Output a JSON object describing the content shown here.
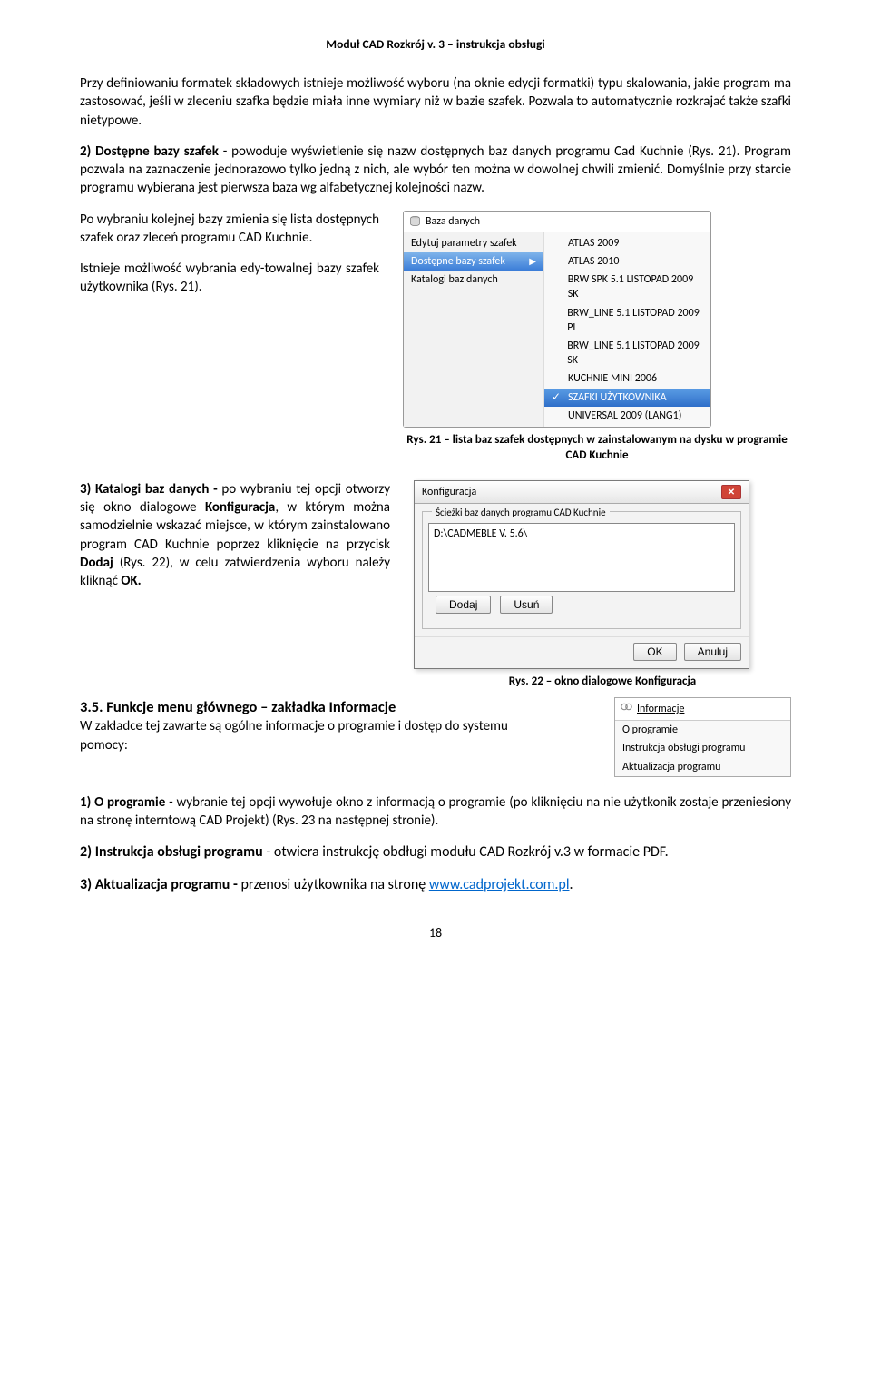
{
  "header": "Moduł CAD Rozkrój v. 3 – instrukcja obsługi",
  "p1": "Przy definiowaniu formatek składowych istnieje możliwość wyboru (na oknie edycji formatki) typu skalowania, jakie program ma zastosować, jeśli w zleceniu szafka będzie miała inne wymiary niż w bazie szafek. Pozwala to automatycznie rozkrajać także szafki nietypowe.",
  "p2a": "2) Dostępne bazy szafek",
  "p2b": " - powoduje wyświetlenie się nazw dostępnych baz danych programu Cad Kuchnie (Rys. 21). Program pozwala na zaznaczenie jednorazowo tylko jedną z nich, ale wybór ten można w dowolnej chwili zmienić. Domyślnie przy starcie programu wybierana jest pierwsza baza wg alfabetycznej kolejności nazw.",
  "left1": "Po wybraniu kolejnej bazy zmienia się lista dostępnych szafek oraz zleceń programu CAD Kuchnie.",
  "left2": "Istnieje możliwość wybrania edy-towalnej bazy szafek użytkownika (Rys. 21).",
  "menu": {
    "title": "Baza danych",
    "left": [
      "Edytuj parametry szafek",
      "Dostępne bazy szafek",
      "Katalogi baz danych"
    ],
    "right": [
      "ATLAS 2009",
      "ATLAS 2010",
      "BRW SPK 5.1 LISTOPAD 2009 SK",
      "BRW_LINE 5.1 LISTOPAD 2009 PL",
      "BRW_LINE 5.1 LISTOPAD 2009 SK",
      "KUCHNIE MINI 2006",
      "SZAFKI UŻYTKOWNIKA",
      "UNIVERSAL 2009 (LANG1)"
    ]
  },
  "cap21": "Rys. 21 – lista baz szafek dostępnych w zainstalowanym na dysku w programie CAD Kuchnie",
  "p3a": "3) Katalogi baz danych - ",
  "p3b": "po wybraniu tej opcji otworzy się okno dialogowe ",
  "p3c": "Konfiguracja",
  "p3d": ", w którym można samodzielnie wskazać miejsce, w którym zainstalowano program CAD Kuchnie poprzez kliknięcie na przycisk ",
  "p3e": "Dodaj",
  "p3f": " (Rys. 22), w celu zatwierdzenia wyboru należy kliknąć ",
  "p3g": "OK.",
  "dialog": {
    "title": "Konfiguracja",
    "fieldset": "Ścieżki baz danych programu CAD Kuchnie",
    "path": "D:\\CADMEBLE V. 5.6\\",
    "add": "Dodaj",
    "remove": "Usuń",
    "ok": "OK",
    "cancel": "Anuluj"
  },
  "cap22": "Rys. 22 – okno dialogowe Konfiguracja",
  "sec35h": "3.5. Funkcje menu głównego – zakładka Informacje",
  "sec35a": "W zakładce tej zawarte są ogólne informacje o programie i dostęp do systemu pomocy:",
  "info_menu": {
    "title": "Informacje",
    "items": [
      "O programie",
      "Instrukcja obsługi programu",
      "Aktualizacja programu"
    ]
  },
  "p4a": "1) O programie",
  "p4b": " - wybranie tej opcji wywołuje okno z  informacją o programie (po kliknięciu na nie użytkonik zostaje przeniesiony na stronę interntową CAD Projekt) (Rys. 23 na następnej stronie).",
  "p5a": "2) Instrukcja obsługi programu",
  "p5b": "  - otwiera instrukcję obdługi modułu CAD Rozkrój v.3 w formacie PDF.",
  "p6a": "3) Aktualizacja programu - ",
  "p6b": "przenosi użytkownika na stronę ",
  "p6c": "www.cadprojekt.com.pl",
  "p6d": ".",
  "page": "18"
}
